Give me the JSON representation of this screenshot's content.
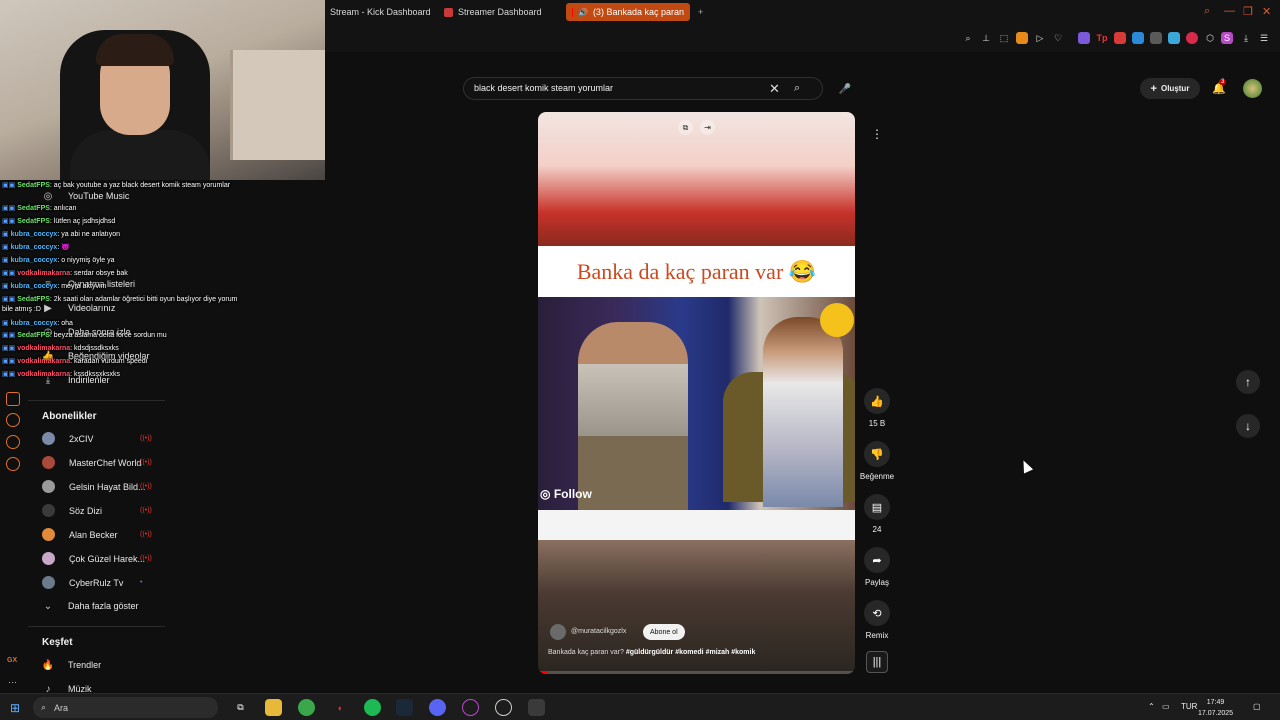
{
  "browser": {
    "tabs": [
      {
        "label": "Stream - Kick Dashboard",
        "active": false
      },
      {
        "label": "Streamer Dashboard",
        "active": false
      },
      {
        "label": "(3) Bankada kaç paran",
        "active": true
      }
    ],
    "new_tab": "+",
    "accent_color": "#c14a13"
  },
  "chat": {
    "messages": [
      {
        "user": "SedatFPS",
        "text": ": aç bak youtube a yaz black desert komik steam yorumlar",
        "color": "#6be36b"
      },
      {
        "user": "SedatFPS",
        "text": ": anlıcan",
        "color": "#6be36b"
      },
      {
        "user": "SedatFPS",
        "text": ": lütfen aç jsdhsjdhsd",
        "color": "#6be36b"
      },
      {
        "user": "kubra_coccyx",
        "text": ": ya abi ne anlatıyon",
        "color": "#4fb8ff"
      },
      {
        "user": "kubra_coccyx",
        "text": ": 👿",
        "color": "#4fb8ff"
      },
      {
        "user": "kubra_coccyx",
        "text": ": o niyymiş öyle ya",
        "color": "#4fb8ff"
      },
      {
        "user": "vodkalimakarna",
        "text": ": serdar obsye bak",
        "color": "#ff4f6a"
      },
      {
        "user": "kubra_coccyx",
        "text": ": meyra aktyvim",
        "color": "#4fb8ff"
      },
      {
        "user": "SedatFPS",
        "text": ": 2k saati olan adamlar öğretici bitti oyun başlıyor diye yorum",
        "color": "#6be36b"
      },
      {
        "user": "",
        "text": "bile atmış :D",
        "color": "#fff"
      },
      {
        "user": "kubra_coccyx",
        "text": ": oha",
        "color": "#4fb8ff"
      },
      {
        "user": "SedatFPS",
        "text": ": beyza aslama delta force sordun mu",
        "color": "#6be36b"
      },
      {
        "user": "vodkalimakarna",
        "text": ": kdsdjssdksxks",
        "color": "#ff4f6a"
      },
      {
        "user": "vodkalimakarna",
        "text": ": karadan vurdum speedi",
        "color": "#ff4f6a"
      },
      {
        "user": "vodkalimakarna",
        "text": ": kşsdksşxksxks",
        "color": "#ff4f6a"
      }
    ]
  },
  "sidebar": {
    "items": [
      {
        "label": "YouTube Music",
        "icon": "youtube-music-icon"
      },
      {
        "label": "Oynatma listeleri",
        "icon": "playlist-icon"
      },
      {
        "label": "Videolarınız",
        "icon": "your-videos-icon"
      },
      {
        "label": "Daha sonra izle",
        "icon": "watch-later-icon"
      },
      {
        "label": "Beğendiğim videolar",
        "icon": "like-icon"
      },
      {
        "label": "İndirilenler",
        "icon": "download-icon"
      }
    ],
    "subscriptions_title": "Abonelikler",
    "subscriptions": [
      {
        "label": "2xCIV",
        "avatar_color": "#7a8aa8",
        "live": true
      },
      {
        "label": "MasterChef World",
        "avatar_color": "#a84a3a",
        "live": true
      },
      {
        "label": "Gelsin Hayat Bild...",
        "avatar_color": "#9a9a9a",
        "live": true
      },
      {
        "label": "Söz Dizi",
        "avatar_color": "#3a3a3a",
        "live": true
      },
      {
        "label": "Alan Becker",
        "avatar_color": "#e08a3a",
        "live": true
      },
      {
        "label": "Çok Güzel Harek...",
        "avatar_color": "#c8a8c8",
        "live": true
      },
      {
        "label": "CyberRulz Tv",
        "avatar_color": "#6a7a8a",
        "live": false
      }
    ],
    "show_more": "Daha fazla göster",
    "explore_title": "Keşfet",
    "explore": [
      {
        "label": "Trendler",
        "icon": "trending-icon"
      },
      {
        "label": "Müzik",
        "icon": "music-icon"
      }
    ]
  },
  "header": {
    "search_value": "black desert komik steam yorumlar",
    "create_label": "Oluştur",
    "notification_count": "3"
  },
  "short": {
    "title_text": "Banka da kaç paran var 😂",
    "watermark": "Follow",
    "channel": "@muratacilkgozlx",
    "subscribe_label": "Abone ol",
    "description": "Bankada kaç paran var?",
    "hashtags": "#güldürgüldür #komedi #mizah #komik",
    "progress": 0.03
  },
  "actions": {
    "like_count": "15 B",
    "dislike_label": "Beğenme",
    "comment_count": "24",
    "share_label": "Paylaş",
    "remix_label": "Remix"
  },
  "taskbar": {
    "search_placeholder": "Ara",
    "language": "TUR",
    "time": "17:49",
    "date": "17.07.2025"
  }
}
